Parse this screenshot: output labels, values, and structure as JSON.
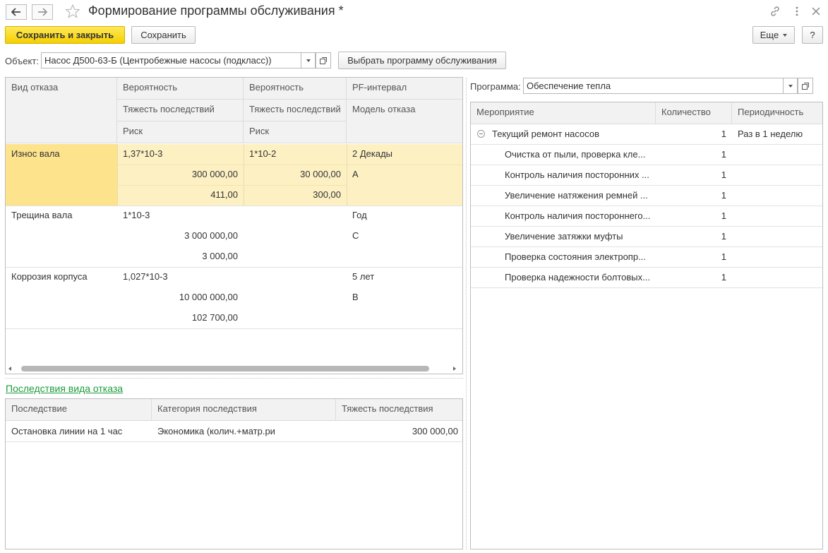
{
  "window": {
    "title": "Формирование программы обслуживания *",
    "back_icon": "arrow-left-icon",
    "forward_icon": "arrow-right-icon",
    "favorite_icon": "star-icon",
    "link_icon": "link-icon",
    "menu_icon": "more-vert-icon",
    "close_icon": "close-icon"
  },
  "toolbar": {
    "save_close_label": "Сохранить и закрыть",
    "save_label": "Сохранить",
    "more_label": "Еще",
    "help_label": "?"
  },
  "object_field": {
    "label": "Объект:",
    "value": "Насос Д500-63-Б (Центробежные насосы (подкласс))",
    "select_program_label": "Выбрать программу обслуживания"
  },
  "failure_table": {
    "headers": {
      "col1": "Вид отказа",
      "col2_r1": "Вероятность",
      "col2_r2": "Тяжесть последствий",
      "col2_r3": "Риск",
      "col3_r1": "Вероятность",
      "col3_r2": "Тяжесть последствий",
      "col3_r3": "Риск",
      "col4_r1": "PF-интервал",
      "col4_r2": "Модель отказа"
    },
    "rows": [
      {
        "name": "Износ вала",
        "prob1": "1,37*10-3",
        "sev1": "300 000,00",
        "risk1": "411,00",
        "prob2": "1*10-2",
        "sev2": "30 000,00",
        "risk2": "300,00",
        "pf": "2 Декады",
        "model": "A"
      },
      {
        "name": "Трещина вала",
        "prob1": "1*10-3",
        "sev1": "3 000 000,00",
        "risk1": "3 000,00",
        "prob2": "",
        "sev2": "",
        "risk2": "",
        "pf": "Год",
        "model": "C"
      },
      {
        "name": "Коррозия корпуса",
        "prob1": "1,027*10-3",
        "sev1": "10 000 000,00",
        "risk1": "102 700,00",
        "prob2": "",
        "sev2": "",
        "risk2": "",
        "pf": "5 лет",
        "model": "B"
      }
    ]
  },
  "consequences": {
    "link_label": "Последствия вида отказа",
    "headers": {
      "col1": "Последствие",
      "col2": "Категория последствия",
      "col3": "Тяжесть последствия"
    },
    "rows": [
      {
        "name": "Остановка линии на 1 час",
        "category": "Экономика (колич.+матр.ри",
        "severity": "300 000,00"
      }
    ]
  },
  "program": {
    "label": "Программа:",
    "value": "Обеспечение тепла",
    "headers": {
      "col1": "Мероприятие",
      "col2": "Количество",
      "col3": "Периодичность"
    },
    "group": {
      "name": "Текущий ремонт насосов",
      "qty": "1",
      "period": "Раз в 1 неделю"
    },
    "items": [
      {
        "name": "Очистка от пыли, проверка кле...",
        "qty": "1"
      },
      {
        "name": "Контроль наличия посторонних ...",
        "qty": "1"
      },
      {
        "name": "Увеличение натяжения ремней ...",
        "qty": "1"
      },
      {
        "name": "Контроль наличия постороннего...",
        "qty": "1"
      },
      {
        "name": "Увеличение затяжки муфты",
        "qty": "1"
      },
      {
        "name": "Проверка состояния электропр...",
        "qty": "1"
      },
      {
        "name": "Проверка надежности болтовых...",
        "qty": "1"
      }
    ]
  },
  "colors": {
    "accent": "#f5cf00",
    "selected_row": "#fdf1c4",
    "selected_cell": "#fce38c",
    "link": "#1a9c3b"
  }
}
